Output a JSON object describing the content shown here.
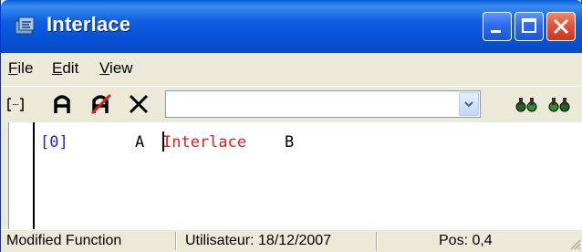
{
  "window": {
    "title": "Interlace"
  },
  "menu": {
    "items": [
      {
        "label": "File",
        "mnemonic": "F",
        "rest": "ile"
      },
      {
        "label": "Edit",
        "mnemonic": "E",
        "rest": "dit"
      },
      {
        "label": "View",
        "mnemonic": "V",
        "rest": "iew"
      }
    ]
  },
  "toolbar": {
    "icons": [
      "bracket-icon",
      "font-a-icon",
      "font-a-strike-icon",
      "delete-x-icon",
      "find-next-icon",
      "find-previous-icon"
    ],
    "combo_value": ""
  },
  "editor": {
    "index_text": "[0]",
    "arg_left": "A",
    "function_name": "Interlace",
    "arg_right": "B",
    "colors": {
      "index": "#1a1aff",
      "keyword": "#e31b1b",
      "text": "#000000"
    }
  },
  "status": {
    "state": "Modified Function",
    "user": "Utilisateur: 18/12/2007",
    "position": "Pos: 0,4"
  },
  "colors": {
    "titlebar": "#0551d6",
    "close": "#e0543a",
    "face": "#ece9d8"
  }
}
